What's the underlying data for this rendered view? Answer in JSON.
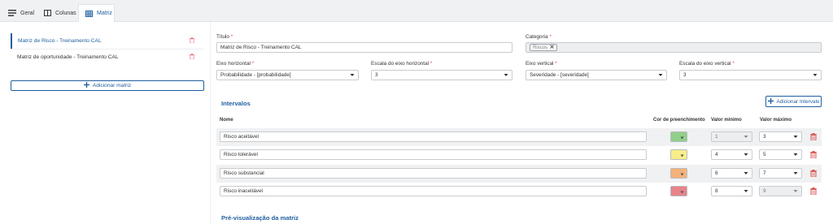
{
  "tabs": [
    {
      "label": "Geral",
      "icon": "list-icon"
    },
    {
      "label": "Colunas",
      "icon": "columns-icon"
    },
    {
      "label": "Matriz",
      "icon": "grid-icon"
    }
  ],
  "sidebar": {
    "items": [
      {
        "label": "Matriz de Risco - Treinamento CAL",
        "selected": true
      },
      {
        "label": "Matriz de oportunidade - Treinamento CAL",
        "selected": false
      }
    ],
    "add_button": "Adicionar matriz"
  },
  "form": {
    "title_label": "Título",
    "title_value": "Matriz de Risco - Treinamento CAL",
    "category_label": "Categoria",
    "category_chip": "Riscos",
    "axis_h_label": "Eixo horizontal",
    "axis_h_value": "Probabilidade - [probabilidade]",
    "scale_h_label": "Escala do eixo horizontal",
    "scale_h_value": "3",
    "axis_v_label": "Eixo vertical",
    "axis_v_value": "Severidade - [severidade]",
    "scale_v_label": "Escala do eixo vertical",
    "scale_v_value": "3",
    "required_mark": "*"
  },
  "intervals": {
    "title": "Intervalos",
    "add_button": "Adicionar Intervalo",
    "headers": {
      "name": "Nome",
      "color": "Cor de preenchimento",
      "min": "Valor mínimo",
      "max": "Valor máximo"
    },
    "rows": [
      {
        "name": "Risco aceitável",
        "color": "#90d08a",
        "min": "1",
        "max": "3",
        "min_disabled": true,
        "max_disabled": false
      },
      {
        "name": "Risco tolerável",
        "color": "#f7ee8a",
        "min": "4",
        "max": "5",
        "min_disabled": false,
        "max_disabled": false
      },
      {
        "name": "Risco substancial",
        "color": "#f5b27a",
        "min": "6",
        "max": "7",
        "min_disabled": false,
        "max_disabled": false
      },
      {
        "name": "Risco inaceitável",
        "color": "#e8838a",
        "min": "8",
        "max": "9",
        "min_disabled": false,
        "max_disabled": true
      }
    ]
  },
  "preview": {
    "title": "Pré-visualização da matriz"
  },
  "colors": {
    "accent": "#1f5fa0",
    "danger": "#d9534f"
  }
}
